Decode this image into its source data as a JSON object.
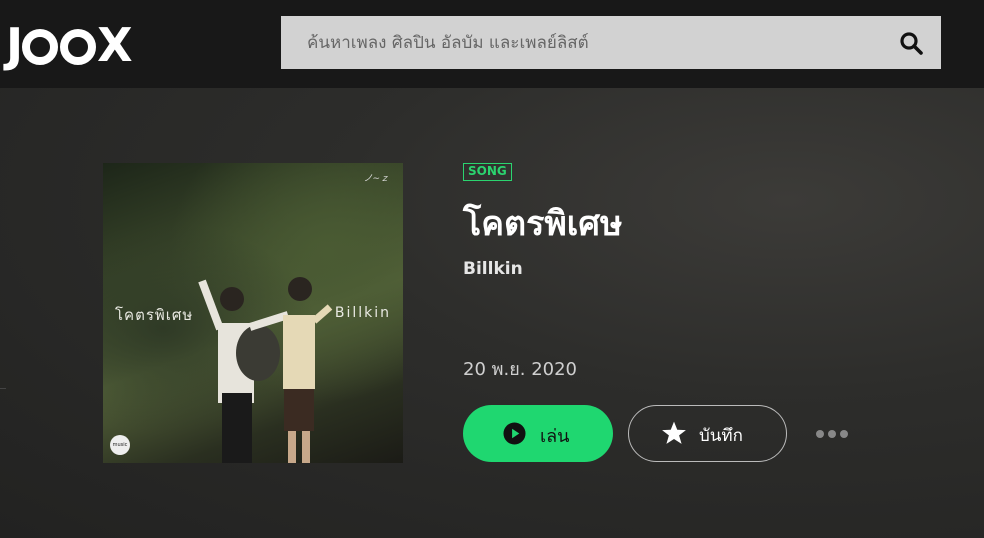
{
  "header": {
    "logo_text": "JOOX",
    "search": {
      "placeholder": "ค้นหาเพลง ศิลปิน อัลบัม และเพลย์ลิสต์",
      "icon": "search-icon"
    }
  },
  "song": {
    "tag": "SONG",
    "title": "โคตรพิเศษ",
    "artist": "Billkin",
    "release_date": "20 พ.ย. 2020",
    "cover": {
      "title_text": "โคตรพิเศษ",
      "artist_text": "Billkin"
    }
  },
  "actions": {
    "play_label": "เล่น",
    "play_icon": "play-icon",
    "save_label": "บันทึก",
    "save_icon": "star-icon",
    "more_icon": "more-icon"
  },
  "colors": {
    "accent": "#1fd770",
    "tag_green": "#2bd46f",
    "search_bg": "#d2d2d2"
  }
}
